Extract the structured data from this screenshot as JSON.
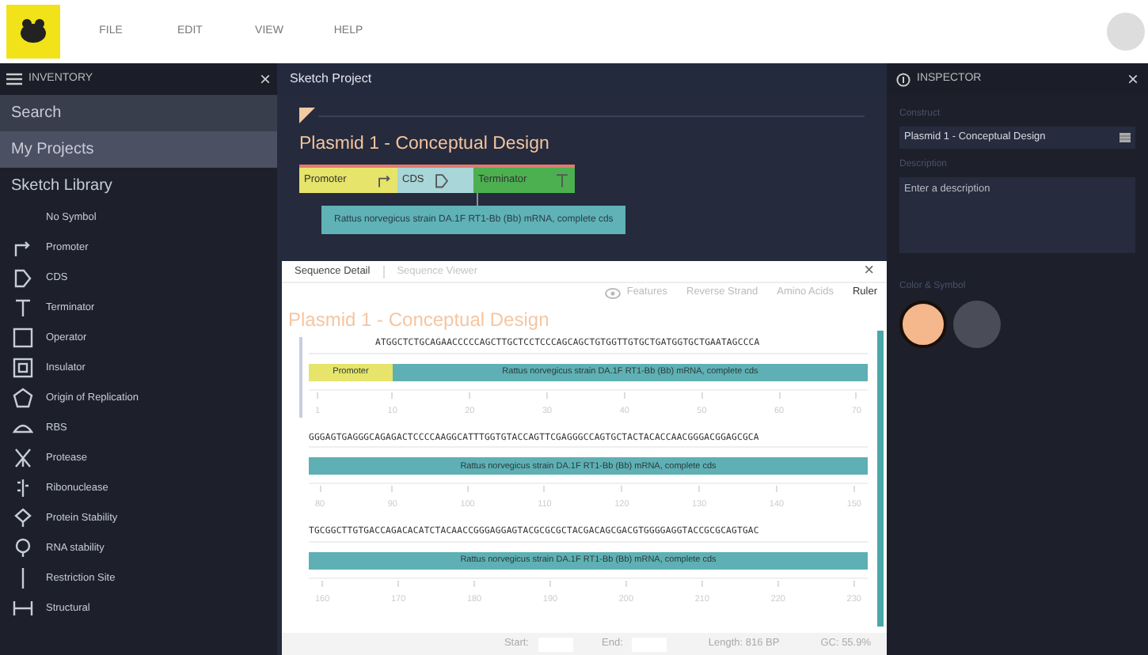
{
  "menu": [
    {
      "label": "FILE"
    },
    {
      "label": "EDIT"
    },
    {
      "label": "VIEW"
    },
    {
      "label": "HELP"
    }
  ],
  "inventory": {
    "title": "INVENTORY",
    "close": "×",
    "nav": [
      {
        "label": "Search",
        "selected": false
      },
      {
        "label": "My Projects",
        "selected": true
      }
    ],
    "library_title": "Sketch Library",
    "symbols": [
      {
        "kind": "none",
        "label": "No Symbol"
      },
      {
        "kind": "promoter",
        "label": "Promoter"
      },
      {
        "kind": "cds",
        "label": "CDS"
      },
      {
        "kind": "terminator",
        "label": "Terminator"
      },
      {
        "kind": "operator",
        "label": "Operator"
      },
      {
        "kind": "insulator",
        "label": "Insulator"
      },
      {
        "kind": "origin",
        "label": "Origin of Replication"
      },
      {
        "kind": "rbs",
        "label": "RBS"
      },
      {
        "kind": "protease",
        "label": "Protease"
      },
      {
        "kind": "ribonuclease",
        "label": "Ribonuclease"
      },
      {
        "kind": "protein-stability",
        "label": "Protein Stability"
      },
      {
        "kind": "rna-stability",
        "label": "RNA stability"
      },
      {
        "kind": "restriction",
        "label": "Restriction Site"
      },
      {
        "kind": "structural",
        "label": "Structural"
      }
    ]
  },
  "project": {
    "title": "Sketch Project",
    "construct_name": "Plasmid 1 - Conceptual Design",
    "parts": [
      {
        "kind": "promoter",
        "label": "Promoter",
        "color": "#e6e46a"
      },
      {
        "kind": "cds",
        "label": "CDS",
        "color": "#a9d6d8"
      },
      {
        "kind": "terminator",
        "label": "Terminator",
        "color": "#4caf50"
      }
    ],
    "annotation": "Rattus norvegicus strain DA.1F RT1-Bb (Bb) mRNA, complete cds"
  },
  "sequence_panel": {
    "tabs": [
      {
        "label": "Sequence Detail",
        "selected": true
      },
      {
        "label": "Sequence Viewer",
        "selected": false
      }
    ],
    "close": "×",
    "toggles": [
      {
        "label": "Features",
        "selected": false
      },
      {
        "label": "Reverse Strand",
        "selected": false
      },
      {
        "label": "Amino Acids",
        "selected": false
      },
      {
        "label": "Ruler",
        "selected": true
      }
    ],
    "title": "Plasmid 1 - Conceptual Design",
    "rows": [
      {
        "sequence": "ATGGCTCTGCAGAACCCCCAGCTTGCTCCTCCCAGCAGCTGTGGTTGTGCTGATGGTGCTGAATAGCCCA",
        "features": [
          {
            "kind": "promoter",
            "label": "Promoter",
            "color": "#e6e46a"
          },
          {
            "kind": "gene",
            "label": "Rattus norvegicus strain DA.1F RT1-Bb (Bb) mRNA, complete cds",
            "color": "#5fb0b4"
          }
        ],
        "ticks": [
          "1",
          "10",
          "20",
          "30",
          "40",
          "50",
          "60",
          "70"
        ]
      },
      {
        "sequence": "GGGAGTGAGGGCAGAGACTCCCCAAGGCATTTGGTGTACCAGTTCGAGGGCCAGTGCTACTACACCAACGGGACGGAGCGCA",
        "features": [
          {
            "kind": "gene",
            "label": "Rattus norvegicus strain DA.1F RT1-Bb (Bb) mRNA, complete cds",
            "color": "#5fb0b4"
          }
        ],
        "ticks": [
          "80",
          "90",
          "100",
          "110",
          "120",
          "130",
          "140",
          "150"
        ]
      },
      {
        "sequence": "TGCGGCTTGTGACCAGACACATCTACAACCGGGAGGAGTACGCGCGCTACGACAGCGACGTGGGGAGGTACCGCGCAGTGAC",
        "features": [
          {
            "kind": "gene",
            "label": "Rattus norvegicus strain DA.1F RT1-Bb (Bb) mRNA, complete cds",
            "color": "#5fb0b4"
          }
        ],
        "ticks": [
          "160",
          "170",
          "180",
          "190",
          "200",
          "210",
          "220",
          "230"
        ]
      }
    ],
    "footer": {
      "start_label": "Start:",
      "end_label": "End:",
      "length": "Length: 816 BP",
      "gc": "GC: 55.9%"
    }
  },
  "inspector": {
    "title": "INSPECTOR",
    "close": "×",
    "construct_label": "Construct",
    "construct_value": "Plasmid 1 - Conceptual Design",
    "description_label": "Description",
    "description_placeholder": "Enter a description",
    "color_label": "Color & Symbol",
    "swatches": [
      {
        "color": "#f4b88c",
        "selected": true
      },
      {
        "color": "#4a4d57",
        "selected": false
      }
    ]
  }
}
